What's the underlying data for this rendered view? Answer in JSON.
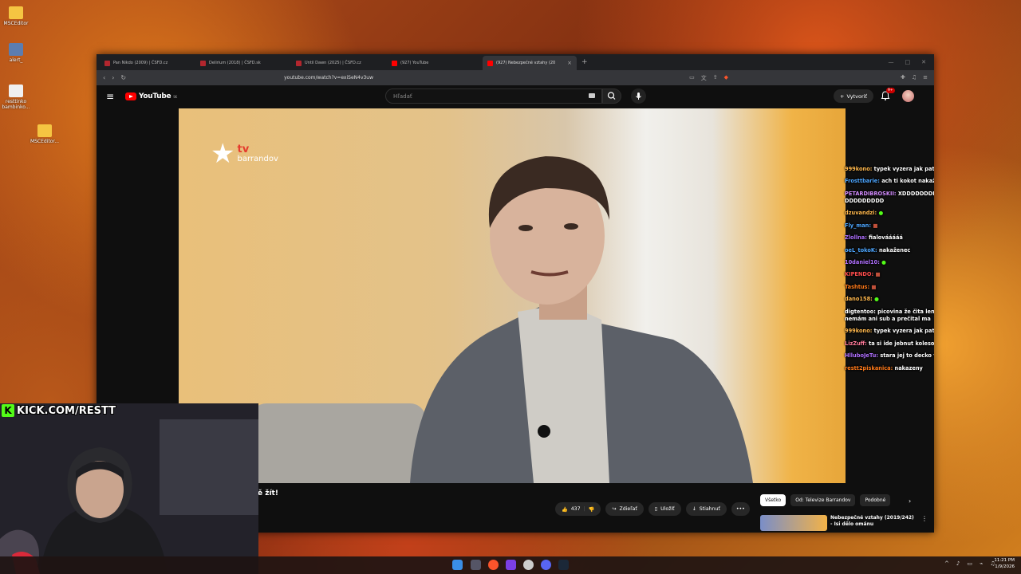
{
  "desktop": {
    "icons": [
      {
        "label": "MSCEditor"
      },
      {
        "label": "alert_"
      },
      {
        "label": "resttinko bambinko..."
      },
      {
        "label": "MSCEditor..."
      }
    ]
  },
  "browser": {
    "tabs": [
      {
        "label": "Pan Nikdo (2009) | ČSFD.cz",
        "color": "#b3262e"
      },
      {
        "label": "Delirium (2018) | ČSFD.sk",
        "color": "#b3262e"
      },
      {
        "label": "Until Dawn (2025) | ČSFD.cz",
        "color": "#b3262e"
      },
      {
        "label": "(927) YouTube",
        "color": "#ff0000"
      },
      {
        "label": "(927) Nebezpečné vztahy (20",
        "color": "#ff0000",
        "active": true
      }
    ],
    "url": "youtube.com/watch?v=exiSeN4v3uw"
  },
  "youtube": {
    "logo_text": "YouTube",
    "logo_region": "SK",
    "search_placeholder": "Hľadať",
    "create_label": "Vytvoriť",
    "bell_badge": "9+",
    "video_title_fragment": "ě žít!",
    "actions": {
      "likes": "437",
      "share": "Zdieľať",
      "save": "Uložiť",
      "download": "Stiahnuť"
    },
    "chips": [
      "Všetko",
      "Od: Televize Barrandov",
      "Podobné"
    ],
    "recommendation": {
      "title_line1": "Nebezpečné vztahy (2019/242)",
      "title_line2": "- Isi dělo ománu"
    },
    "colors": {
      "brand_red": "#ff0000",
      "bg": "#0f0f0f"
    }
  },
  "video": {
    "channel_logo_tv": "tv",
    "channel_logo_brand": "barrandov"
  },
  "chat": [
    {
      "user": "999kono:",
      "text": "typek vyzera jak pat a mat",
      "color": "#ffb84d"
    },
    {
      "user": "Frosttbarie:",
      "text": "ach ti kokot nakažení",
      "color": "#4da6ff"
    },
    {
      "user": "PETARDIBROSKII:",
      "text": "XDDDDDDDDDDDDDD DDDDDDDDD",
      "color": "#d38cff"
    },
    {
      "user": "dzuvandzi:",
      "text": "",
      "color": "#ffb84d"
    },
    {
      "user": "Fly_man:",
      "text": "",
      "color": "#4da6ff"
    },
    {
      "user": "Zlollna:",
      "text": "fialovááááá",
      "color": "#b070ff"
    },
    {
      "user": "oeL_tokoK:",
      "text": "nakaženec",
      "color": "#4da6ff"
    },
    {
      "user": "10daniel10:",
      "text": "",
      "color": "#b070ff"
    },
    {
      "user": "KIPENDO:",
      "text": "",
      "color": "#ff4d4d"
    },
    {
      "user": "Tashtus:",
      "text": "",
      "color": "#ff7a1a"
    },
    {
      "user": "dano158:",
      "text": "",
      "color": "#ffb84d"
    },
    {
      "user": "digtentoo:",
      "text": "picovina že čita len ženske nicky. nemám ani sub a prečital ma",
      "color": "#ffffff"
    },
    {
      "user": "999kono:",
      "text": "typek vyzera jak pat a mat @restt",
      "color": "#ffb84d"
    },
    {
      "user": "LizZuff:",
      "text": "ta si ide jebnut koleso rovno",
      "color": "#ff7a9a"
    },
    {
      "user": "HlluboJeTu:",
      "text": "stara jej to decko vyskrabe",
      "color": "#b070ff"
    },
    {
      "user": "restt2piskanica:",
      "text": "nakazeny",
      "color": "#ff7a1a"
    }
  ],
  "webcam": {
    "overlay_text": "KICK.COM/RESTT",
    "kick_color": "#53fc18"
  },
  "taskbar": {
    "time": "11:21 PM",
    "date": "1/9/2026"
  }
}
